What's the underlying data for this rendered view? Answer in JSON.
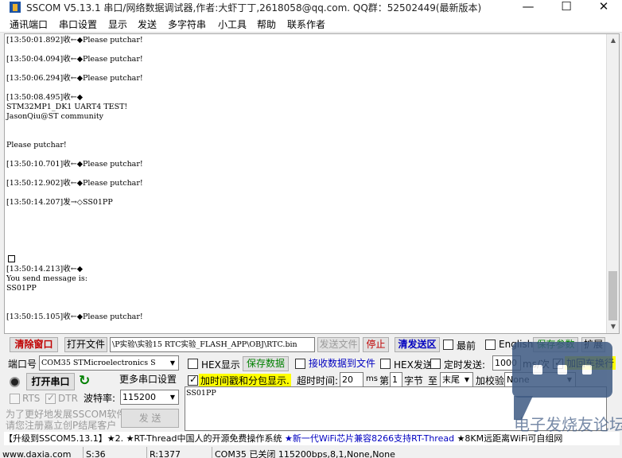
{
  "window": {
    "title": "SSCOM V5.13.1 串口/网络数据调试器,作者:大虾丁丁,2618058@qq.com. QQ群：52502449(最新版本)",
    "controls": {
      "minimize": "—",
      "maximize": "☐",
      "close": "✕"
    }
  },
  "menu": [
    "通讯端口",
    "串口设置",
    "显示",
    "发送",
    "多字符串",
    "小工具",
    "帮助",
    "联系作者"
  ],
  "log_lines": [
    "[13:50:01.892]收←◆Please putchar!",
    "[13:50:04.094]收←◆Please putchar!",
    "[13:50:06.294]收←◆Please putchar!",
    "[13:50:08.495]收←◆",
    "STM32MP1_DK1 UART4 TEST!",
    "JasonQiu@ST community",
    "Please putchar!",
    "[13:50:10.701]收←◆Please putchar!",
    "[13:50:12.902]收←◆Please putchar!",
    "[13:50:14.207]发→◇SS01PP",
    "[13:50:14.213]收←◆",
    "You send message is:",
    "SS01PP",
    "[13:50:15.105]收←◆Please putchar!"
  ],
  "toolbar": {
    "clear_window": "清除窗口",
    "open_file": "打开文件",
    "file_path": "\\P实验\\实验15 RTC实验_FLASH_APP\\OBJ\\RTC.bin",
    "send_file": "发送文件",
    "stop": "停止",
    "clear_send": "清发送区",
    "topmost": "最前",
    "english": "English",
    "save_params": "保存参数",
    "expand": "扩展"
  },
  "settings": {
    "port_label": "端口号",
    "port_value": "COM35 STMicroelectronics S",
    "hex_display": "HEX显示",
    "save_data": "保存数据",
    "recv_to_file": "接收数据到文件",
    "hex_send": "HEX发送",
    "timed_send": "定时发送:",
    "interval_value": "1000",
    "interval_unit": "ms/次",
    "add_crlf": "加回车换行",
    "open_port": "打开串口",
    "more_settings": "更多串口设置",
    "add_timestamp": "加时间戳和分包显示.",
    "timeout_label": "超时时间:",
    "timeout_value": "20",
    "timeout_unit": "ms",
    "byte_index_prefix": "第",
    "byte_index_value": "1",
    "byte_index_suffix": "字节",
    "to_label": "至",
    "to_value": "末尾",
    "checksum_label": "加校验",
    "checksum_value": "None",
    "rts": "RTS",
    "dtr": "DTR",
    "baud_label": "波特率:",
    "baud_value": "115200",
    "promo_line1": "为了更好地发展SSCOM软件",
    "promo_line2": "请您注册嘉立创P结尾客户",
    "send_button": "发 送",
    "send_text": "SS01PP"
  },
  "ticker": {
    "part1": "【升级到SSCOM5.13.1】★2. ★RT-Thread中国人的开源免费操作系统 ",
    "part2": "★新一代WiFi芯片兼容8266支持RT-Thread",
    "part3": " ★8KM远距离WiFi可自组网"
  },
  "status": {
    "site": "www.daxia.com",
    "sent": "S:36",
    "received": "R:1377",
    "port_status": "COM35 已关闭  115200bps,8,1,None,None"
  },
  "watermark": {
    "text": "电子发烧友论坛"
  },
  "colors": {
    "accent_red": "#c00000",
    "accent_green": "#008000",
    "accent_blue": "#0000c0",
    "highlight_yellow": "#ffff00"
  }
}
